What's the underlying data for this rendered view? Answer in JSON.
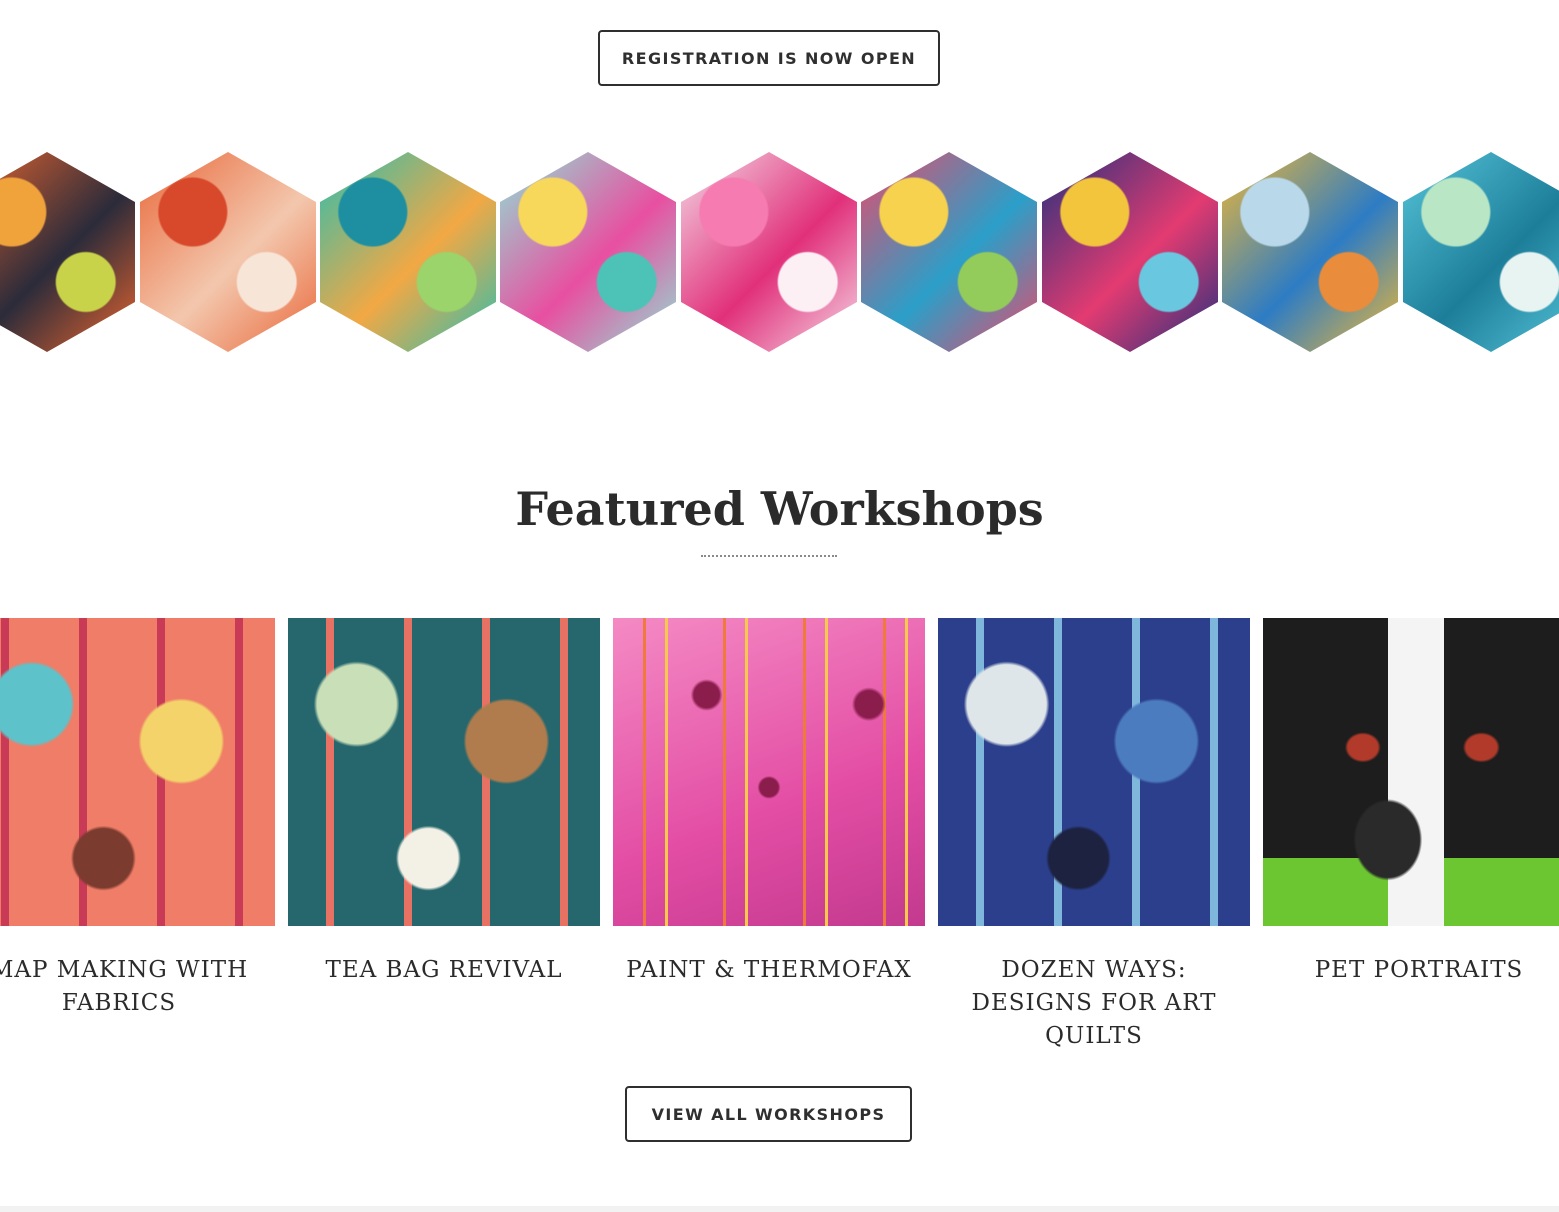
{
  "registration_button": {
    "label": "REGISTRATION IS NOW OPEN"
  },
  "hex_gallery": {
    "tiles": [
      {
        "name": "hex-art-orange-x-collage",
        "colors": [
          "#e8652f",
          "#2b2b3a",
          "#f0a23b",
          "#c9d34a"
        ]
      },
      {
        "name": "hex-art-girl-silhouette",
        "colors": [
          "#e9683a",
          "#f3c7ad",
          "#d8492c",
          "#f7e5d8"
        ]
      },
      {
        "name": "hex-art-turquoise-botanical",
        "colors": [
          "#2bbfb0",
          "#f2a844",
          "#1d8fa0",
          "#9ad46b"
        ]
      },
      {
        "name": "hex-art-floral-vase",
        "colors": [
          "#8ee3d6",
          "#e84fa0",
          "#f7d85b",
          "#4cc3b6"
        ]
      },
      {
        "name": "hex-art-pink-watercolor",
        "colors": [
          "#f4d9e6",
          "#e1307a",
          "#f57bb0",
          "#fdf0f5"
        ]
      },
      {
        "name": "hex-art-circles-quilt",
        "colors": [
          "#e94a6a",
          "#2a9fc9",
          "#f6d24e",
          "#93cc5a"
        ]
      },
      {
        "name": "hex-art-abstract-mosaic",
        "colors": [
          "#23307e",
          "#e33b71",
          "#f2c53d",
          "#6ac7e0"
        ]
      },
      {
        "name": "hex-art-blue-landscape",
        "colors": [
          "#f0b835",
          "#2d7cc4",
          "#b9d8ea",
          "#e98c3b"
        ]
      },
      {
        "name": "hex-art-fish-dye",
        "colors": [
          "#56c4d8",
          "#1d7e9a",
          "#b9e6c4",
          "#e7f4f1"
        ]
      }
    ]
  },
  "featured": {
    "title": "Featured Workshops",
    "workshops": [
      {
        "title": "MAP MAKING WITH FABRICS",
        "colors": [
          "#ef7d67",
          "#c93a57",
          "#5dc2c9",
          "#f3d36a",
          "#7b3b2f"
        ]
      },
      {
        "title": "TEA BAG REVIVAL",
        "colors": [
          "#25676d",
          "#e77263",
          "#c9dfb8",
          "#b07c4e",
          "#f3f1e6"
        ]
      },
      {
        "title": "PAINT & THERMOFAX",
        "colors": [
          "#e34da4",
          "#f07a3a",
          "#f6c84c",
          "#8a1d4c",
          "#f48ac4"
        ]
      },
      {
        "title": "DOZEN WAYS: DESIGNS FOR ART QUILTS",
        "colors": [
          "#2c3f8c",
          "#7fb6dc",
          "#dfe6ea",
          "#4c7cc0",
          "#1c2240"
        ]
      },
      {
        "title": "PET PORTRAITS",
        "colors": [
          "#1d1d1d",
          "#f4f4f4",
          "#6cc631",
          "#b23a2a",
          "#7a7a7a"
        ]
      }
    ]
  },
  "view_all_button": {
    "label": "VIEW ALL WORKSHOPS"
  }
}
